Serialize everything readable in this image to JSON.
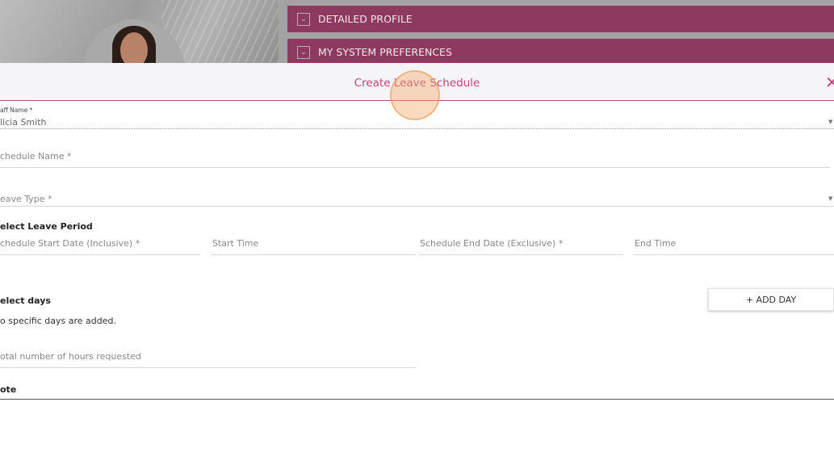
{
  "background": {
    "accordion_items": [
      {
        "label": "DETAILED PROFILE"
      },
      {
        "label": "MY SYSTEM PREFERENCES"
      }
    ]
  },
  "modal": {
    "title": "Create Leave Schedule",
    "close_icon": "close-icon",
    "fields": {
      "staff_name": {
        "label": "aff Name *",
        "value": "licia Smith"
      },
      "schedule_name": {
        "placeholder": "chedule Name *"
      },
      "leave_type": {
        "placeholder": "eave Type *"
      }
    },
    "leave_period": {
      "title": "elect Leave Period",
      "start_date": "chedule Start Date (Inclusive) *",
      "start_time": "Start Time",
      "end_date": "Schedule End Date (Exclusive) *",
      "end_time": "End Time"
    },
    "days": {
      "title": "elect days",
      "empty_text": "o specific days are added.",
      "add_button": "+ ADD DAY"
    },
    "hours": {
      "placeholder": "otal number of hours requested"
    },
    "note": {
      "label": "ote"
    }
  },
  "colors": {
    "accent": "#c2447f",
    "accordion_bg": "#8e3a5e"
  }
}
